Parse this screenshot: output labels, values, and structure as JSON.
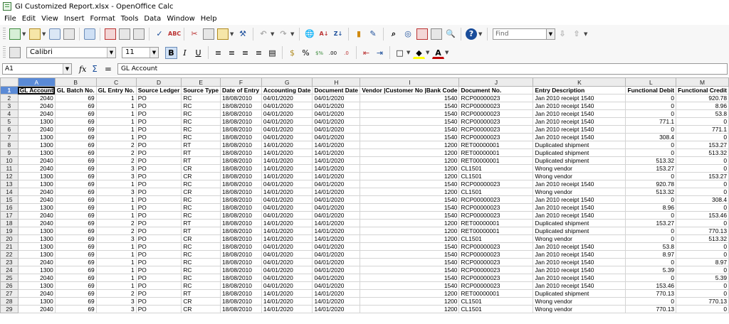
{
  "window": {
    "title": "GI Customized Report.xlsx - OpenOffice Calc"
  },
  "menu": [
    "File",
    "Edit",
    "View",
    "Insert",
    "Format",
    "Tools",
    "Data",
    "Window",
    "Help"
  ],
  "find": {
    "placeholder": "Find"
  },
  "font": {
    "name": "Calibri",
    "size": "11"
  },
  "formula_bar": {
    "cell_ref": "A1",
    "content": "GL Account"
  },
  "columns": [
    "A",
    "B",
    "C",
    "D",
    "E",
    "F",
    "G",
    "H",
    "I",
    "J",
    "K",
    "L",
    "M"
  ],
  "header_row": [
    "GL Account",
    "GL Batch No.",
    "GL Entry No.",
    "Source Ledger",
    "Source Type",
    "Date of Entry",
    "Accounting Date",
    "Document Date",
    "Vendor |Customer No |Bank Code",
    "Document No.",
    "Entry Description",
    "Functional Debit",
    "Functional Credit"
  ],
  "rows": [
    [
      "2040",
      "69",
      "1",
      "PO",
      "RC",
      "18/08/2010",
      "04/01/2020",
      "04/01/2020",
      "1540",
      "RCP00000023",
      "Jan 2010 receipt 1540",
      "0",
      "920.78"
    ],
    [
      "2040",
      "69",
      "1",
      "PO",
      "RC",
      "18/08/2010",
      "04/01/2020",
      "04/01/2020",
      "1540",
      "RCP00000023",
      "Jan 2010 receipt 1540",
      "0",
      "8.96"
    ],
    [
      "2040",
      "69",
      "1",
      "PO",
      "RC",
      "18/08/2010",
      "04/01/2020",
      "04/01/2020",
      "1540",
      "RCP00000023",
      "Jan 2010 receipt 1540",
      "0",
      "53.8"
    ],
    [
      "1300",
      "69",
      "1",
      "PO",
      "RC",
      "18/08/2010",
      "04/01/2020",
      "04/01/2020",
      "1540",
      "RCP00000023",
      "Jan 2010 receipt 1540",
      "771.1",
      "0"
    ],
    [
      "2040",
      "69",
      "1",
      "PO",
      "RC",
      "18/08/2010",
      "04/01/2020",
      "04/01/2020",
      "1540",
      "RCP00000023",
      "Jan 2010 receipt 1540",
      "0",
      "771.1"
    ],
    [
      "1300",
      "69",
      "1",
      "PO",
      "RC",
      "18/08/2010",
      "04/01/2020",
      "04/01/2020",
      "1540",
      "RCP00000023",
      "Jan 2010 receipt 1540",
      "308.4",
      "0"
    ],
    [
      "1300",
      "69",
      "2",
      "PO",
      "RT",
      "18/08/2010",
      "14/01/2020",
      "14/01/2020",
      "1200",
      "RET00000001",
      "Duplicated shipment",
      "0",
      "153.27"
    ],
    [
      "1300",
      "69",
      "2",
      "PO",
      "RT",
      "18/08/2010",
      "14/01/2020",
      "14/01/2020",
      "1200",
      "RET00000001",
      "Duplicated shipment",
      "0",
      "513.32"
    ],
    [
      "2040",
      "69",
      "2",
      "PO",
      "RT",
      "18/08/2010",
      "14/01/2020",
      "14/01/2020",
      "1200",
      "RET00000001",
      "Duplicated shipment",
      "513.32",
      "0"
    ],
    [
      "2040",
      "69",
      "3",
      "PO",
      "CR",
      "18/08/2010",
      "14/01/2020",
      "14/01/2020",
      "1200",
      "CL1501",
      "Wrong vendor",
      "153.27",
      "0"
    ],
    [
      "1300",
      "69",
      "3",
      "PO",
      "CR",
      "18/08/2010",
      "14/01/2020",
      "14/01/2020",
      "1200",
      "CL1501",
      "Wrong vendor",
      "0",
      "153.27"
    ],
    [
      "1300",
      "69",
      "1",
      "PO",
      "RC",
      "18/08/2010",
      "04/01/2020",
      "04/01/2020",
      "1540",
      "RCP00000023",
      "Jan 2010 receipt 1540",
      "920.78",
      "0"
    ],
    [
      "2040",
      "69",
      "3",
      "PO",
      "CR",
      "18/08/2010",
      "14/01/2020",
      "14/01/2020",
      "1200",
      "CL1501",
      "Wrong vendor",
      "513.32",
      "0"
    ],
    [
      "2040",
      "69",
      "1",
      "PO",
      "RC",
      "18/08/2010",
      "04/01/2020",
      "04/01/2020",
      "1540",
      "RCP00000023",
      "Jan 2010 receipt 1540",
      "0",
      "308.4"
    ],
    [
      "1300",
      "69",
      "1",
      "PO",
      "RC",
      "18/08/2010",
      "04/01/2020",
      "04/01/2020",
      "1540",
      "RCP00000023",
      "Jan 2010 receipt 1540",
      "8.96",
      "0"
    ],
    [
      "2040",
      "69",
      "1",
      "PO",
      "RC",
      "18/08/2010",
      "04/01/2020",
      "04/01/2020",
      "1540",
      "RCP00000023",
      "Jan 2010 receipt 1540",
      "0",
      "153.46"
    ],
    [
      "2040",
      "69",
      "2",
      "PO",
      "RT",
      "18/08/2010",
      "14/01/2020",
      "14/01/2020",
      "1200",
      "RET00000001",
      "Duplicated shipment",
      "153.27",
      "0"
    ],
    [
      "1300",
      "69",
      "2",
      "PO",
      "RT",
      "18/08/2010",
      "14/01/2020",
      "14/01/2020",
      "1200",
      "RET00000001",
      "Duplicated shipment",
      "0",
      "770.13"
    ],
    [
      "1300",
      "69",
      "3",
      "PO",
      "CR",
      "18/08/2010",
      "14/01/2020",
      "14/01/2020",
      "1200",
      "CL1501",
      "Wrong vendor",
      "0",
      "513.32"
    ],
    [
      "1300",
      "69",
      "1",
      "PO",
      "RC",
      "18/08/2010",
      "04/01/2020",
      "04/01/2020",
      "1540",
      "RCP00000023",
      "Jan 2010 receipt 1540",
      "53.8",
      "0"
    ],
    [
      "1300",
      "69",
      "1",
      "PO",
      "RC",
      "18/08/2010",
      "04/01/2020",
      "04/01/2020",
      "1540",
      "RCP00000023",
      "Jan 2010 receipt 1540",
      "8.97",
      "0"
    ],
    [
      "2040",
      "69",
      "1",
      "PO",
      "RC",
      "18/08/2010",
      "04/01/2020",
      "04/01/2020",
      "1540",
      "RCP00000023",
      "Jan 2010 receipt 1540",
      "0",
      "8.97"
    ],
    [
      "1300",
      "69",
      "1",
      "PO",
      "RC",
      "18/08/2010",
      "04/01/2020",
      "04/01/2020",
      "1540",
      "RCP00000023",
      "Jan 2010 receipt 1540",
      "5.39",
      "0"
    ],
    [
      "2040",
      "69",
      "1",
      "PO",
      "RC",
      "18/08/2010",
      "04/01/2020",
      "04/01/2020",
      "1540",
      "RCP00000023",
      "Jan 2010 receipt 1540",
      "0",
      "5.39"
    ],
    [
      "1300",
      "69",
      "1",
      "PO",
      "RC",
      "18/08/2010",
      "04/01/2020",
      "04/01/2020",
      "1540",
      "RCP00000023",
      "Jan 2010 receipt 1540",
      "153.46",
      "0"
    ],
    [
      "2040",
      "69",
      "2",
      "PO",
      "RT",
      "18/08/2010",
      "14/01/2020",
      "14/01/2020",
      "1200",
      "RET00000001",
      "Duplicated shipment",
      "770.13",
      "0"
    ],
    [
      "1300",
      "69",
      "3",
      "PO",
      "CR",
      "18/08/2010",
      "14/01/2020",
      "14/01/2020",
      "1200",
      "CL1501",
      "Wrong vendor",
      "0",
      "770.13"
    ],
    [
      "2040",
      "69",
      "3",
      "PO",
      "CR",
      "18/08/2010",
      "14/01/2020",
      "14/01/2020",
      "1200",
      "CL1501",
      "Wrong vendor",
      "770.13",
      "0"
    ]
  ],
  "icons": {
    "toolbar1": [
      "new-icon",
      "open-icon",
      "save-icon",
      "email-icon",
      "edit-file-icon",
      "export-pdf-icon",
      "print-icon",
      "page-preview-icon",
      "spellcheck-icon",
      "autospellcheck-icon",
      "cut-icon",
      "copy-icon",
      "paste-icon",
      "clone-format-icon",
      "undo-icon",
      "redo-icon",
      "hyperlink-icon",
      "sort-ascending-icon",
      "sort-descending-icon",
      "chart-icon",
      "show-draw-functions-icon",
      "find-replace-icon",
      "navigator-icon",
      "gallery-icon",
      "data-sources-icon",
      "zoom-icon",
      "help-icon"
    ],
    "toolbar2": [
      "styles-formatting-icon",
      "bold-icon",
      "italic-icon",
      "underline-icon",
      "align-left-icon",
      "align-center-icon",
      "align-right-icon",
      "justify-icon",
      "merge-cells-icon",
      "currency-icon",
      "percent-icon",
      "standard-number-icon",
      "add-decimal-icon",
      "delete-decimal-icon",
      "decrease-indent-icon",
      "increase-indent-icon",
      "borders-icon",
      "background-color-icon",
      "font-color-icon"
    ]
  }
}
